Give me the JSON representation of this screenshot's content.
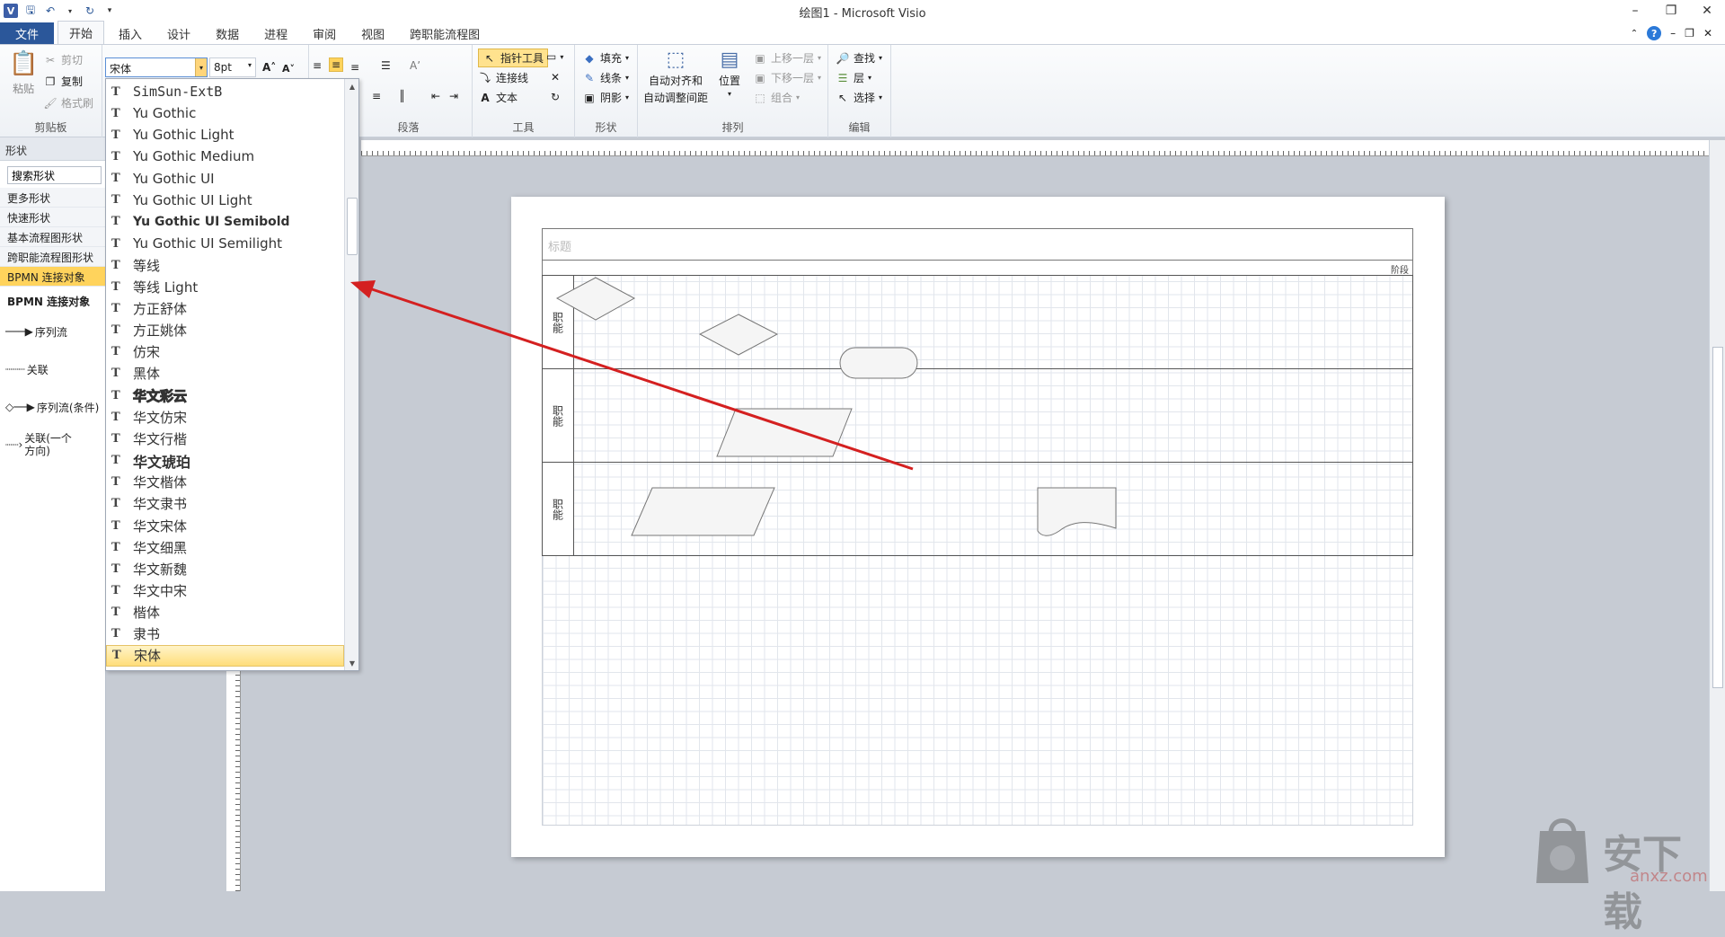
{
  "window": {
    "title": "绘图1 - Microsoft Visio",
    "app_letter": "V"
  },
  "tabs": [
    "文件",
    "开始",
    "插入",
    "设计",
    "数据",
    "进程",
    "审阅",
    "视图",
    "跨职能流程图"
  ],
  "ribbon": {
    "clipboard": {
      "paste": "粘贴",
      "cut": "剪切",
      "copy": "复制",
      "format_painter": "格式刷",
      "label": "剪贴板"
    },
    "font": {
      "name": "宋体",
      "size": "8pt"
    },
    "paragraph": {
      "label": "段落"
    },
    "tools": {
      "pointer": "指针工具",
      "connector": "连接线",
      "text": "文本",
      "label": "工具"
    },
    "shape": {
      "fill": "填充",
      "line": "线条",
      "shadow": "阴影",
      "label": "形状"
    },
    "arrange": {
      "auto_align": "自动对齐和",
      "auto_space": "自动调整间距",
      "position": "位置",
      "bring_forward": "上移一层",
      "send_backward": "下移一层",
      "group": "组合",
      "label": "排列"
    },
    "editing": {
      "find": "查找",
      "layers": "层",
      "select": "选择",
      "label": "编辑"
    }
  },
  "shapes_panel": {
    "header": "形状",
    "search_value": "搜索形状",
    "stencils": [
      "更多形状",
      "快速形状",
      "基本流程图形状",
      "跨职能流程图形状",
      "BPMN 连接对象"
    ],
    "active_stencil": "BPMN 连接对象",
    "stencil_title": "BPMN 连接对象",
    "shapes": [
      "序列流",
      "关联",
      "序列流(条件)",
      "关联(一个方向)"
    ]
  },
  "font_list": [
    "SimSun-ExtB",
    "Yu Gothic",
    "Yu Gothic Light",
    "Yu Gothic Medium",
    "Yu Gothic UI",
    "Yu Gothic UI Light",
    "Yu Gothic UI Semibold",
    "Yu Gothic UI Semilight",
    "等线",
    "等线 Light",
    "方正舒体",
    "方正姚体",
    "仿宋",
    "黑体",
    "华文彩云",
    "华文仿宋",
    "华文行楷",
    "华文琥珀",
    "华文楷体",
    "华文隶书",
    "华文宋体",
    "华文细黑",
    "华文新魏",
    "华文中宋",
    "楷体",
    "隶书",
    "宋体"
  ],
  "selected_font": "宋体",
  "diagram": {
    "pool_title": "标题",
    "phase": "阶段",
    "lanes": [
      "职能",
      "职能",
      "职能"
    ]
  },
  "watermark": {
    "text": "安下载",
    "url": "anxz.com"
  },
  "colors": {
    "file_tab": "#2b579a",
    "accent_yellow": "#ffd35c",
    "arrow": "#d42020"
  }
}
